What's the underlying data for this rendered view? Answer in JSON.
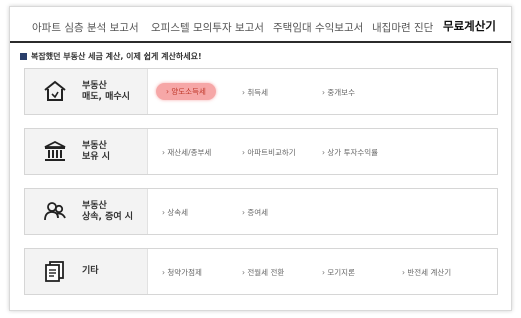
{
  "tabs": [
    {
      "label": "아파트 심층 분석 보고서",
      "active": false
    },
    {
      "label": "오피스텔 모의투자 보고서",
      "active": false
    },
    {
      "label": "주택임대 수익보고서",
      "active": false
    },
    {
      "label": "내집마련 진단",
      "active": false
    },
    {
      "label": "무료계산기",
      "active": true
    }
  ],
  "notice": "복잡했던 부동산 세금 계산, 이제 쉽게 계산하세요!",
  "categories": [
    {
      "label_line1": "부동산",
      "label_line2": "매도, 매수시",
      "icon": "house-icon",
      "links": [
        "› 양도소득세",
        "› 취득세",
        "› 중개보수"
      ]
    },
    {
      "label_line1": "부동산",
      "label_line2": "보유 시",
      "icon": "bank-icon",
      "links": [
        "› 재산세/종부세",
        "› 아파트비교하기",
        "› 상가 투자수익률"
      ]
    },
    {
      "label_line1": "부동산",
      "label_line2": "상속, 증여 시",
      "icon": "people-icon",
      "links": [
        "› 상속세",
        "› 증여세"
      ]
    },
    {
      "label_line1": "기타",
      "label_line2": "",
      "icon": "documents-icon",
      "links": [
        "› 청약가점제",
        "› 전월세 전환",
        "› 모기지론",
        "› 반전세 계산기"
      ]
    }
  ],
  "colors": {
    "active_pill_bg": "#f6a7a7",
    "active_pill_text": "#c0392b",
    "notice_square": "#2a3f6b",
    "tab_underline": "#2b2b2b"
  }
}
